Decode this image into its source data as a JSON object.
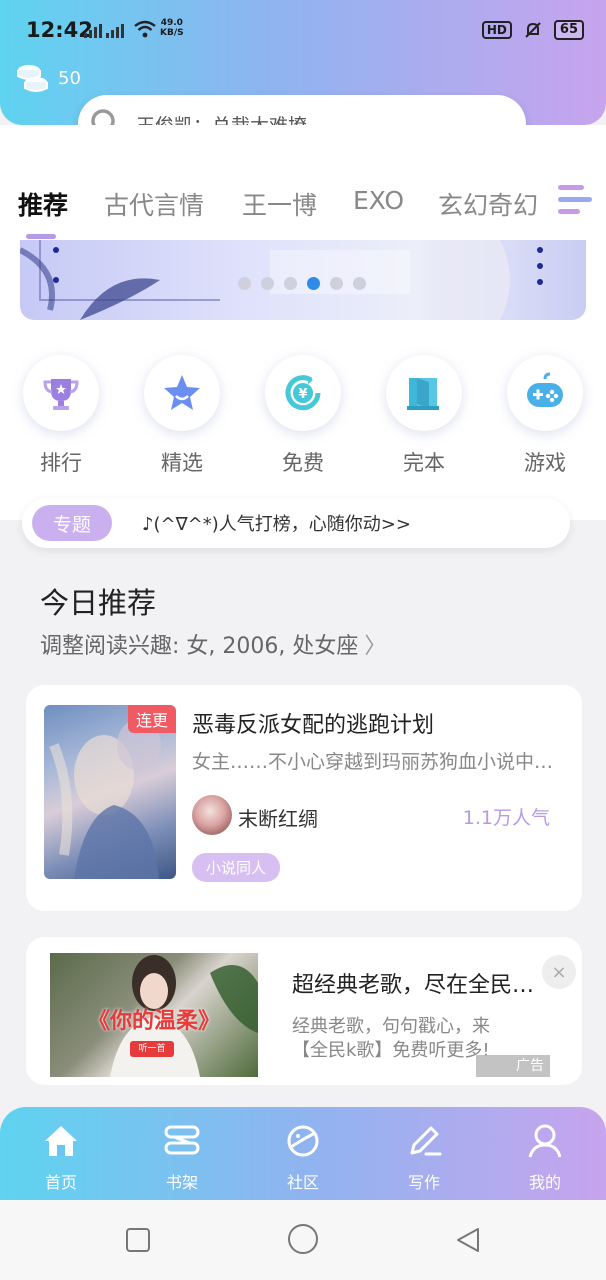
{
  "status": {
    "time": "12:42",
    "network_speed": "49.0",
    "network_unit": "KB/S",
    "battery": "65",
    "hd_label": "HD"
  },
  "header": {
    "coins": "50",
    "search_placeholder": "王俊凯：总裁太难撩"
  },
  "tabs": [
    {
      "label": "推荐",
      "active": true
    },
    {
      "label": "古代言情",
      "active": false
    },
    {
      "label": "王一博",
      "active": false
    },
    {
      "label": "EXO",
      "active": false
    },
    {
      "label": "玄幻奇幻",
      "active": false
    }
  ],
  "banner": {
    "dot_count": 6,
    "active_dot": 3
  },
  "quick_links": [
    {
      "label": "排行",
      "icon": "trophy-icon"
    },
    {
      "label": "精选",
      "icon": "star-icon"
    },
    {
      "label": "免费",
      "icon": "yuan-icon"
    },
    {
      "label": "完本",
      "icon": "book-icon"
    },
    {
      "label": "游戏",
      "icon": "gamepad-icon"
    }
  ],
  "topic": {
    "badge": "专题",
    "text": "♪(^∇^*)人气打榜，心随你动>>"
  },
  "recommend": {
    "title": "今日推荐",
    "subtitle": "调整阅读兴趣: 女, 2006, 处女座",
    "book": {
      "badge": "连更",
      "title": "恶毒反派女配的逃跑计划",
      "desc": "女主……不小心穿越到玛丽苏狗血小说中…",
      "author": "末断红绸",
      "popularity": "1.1万人气",
      "tag": "小说同人"
    }
  },
  "ad": {
    "image_text": "《你的温柔》",
    "image_button": "听一首",
    "title": "超经典老歌，尽在全民…",
    "desc": "经典老歌，句句戳心，来【全民k歌】免费听更多!",
    "label": "广告",
    "close": "×"
  },
  "bottom_nav": [
    {
      "label": "首页",
      "icon": "home-icon"
    },
    {
      "label": "书架",
      "icon": "bookshelf-icon"
    },
    {
      "label": "社区",
      "icon": "planet-icon"
    },
    {
      "label": "写作",
      "icon": "pen-icon"
    },
    {
      "label": "我的",
      "icon": "user-icon"
    }
  ],
  "colors": {
    "accent": "#b79ae6",
    "gradient_start": "#5fd3f0",
    "gradient_end": "#c7a4ee",
    "badge_red": "#f05a62"
  }
}
